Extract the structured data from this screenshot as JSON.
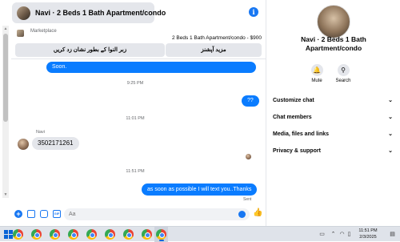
{
  "header": {
    "title": "Navi · 2 Beds 1 Bath Apartment/condo"
  },
  "marketplace": {
    "label": "Marketplace",
    "listing": "2 Beds 1 Bath Apartment/condo - $900",
    "button_1": "زبر النوا کے بطور نشان زد کریں",
    "button_2": "مزید آپشنز"
  },
  "messages": {
    "m1": "Soon.",
    "t1": "9:25 PM",
    "m2": "??",
    "t2": "11:01 PM",
    "sender": "Navi",
    "m3": "3502171261",
    "t3": "11:51 PM",
    "m4": "as soon as possible I will text you..Thanks",
    "status": "Sent"
  },
  "composer": {
    "placeholder": "Aa"
  },
  "panel": {
    "title": "Navi · 2 Beds 1 Bath Apartment/condo",
    "mute_label": "Mute",
    "search_label": "Search",
    "sections": [
      "Customize chat",
      "Chat members",
      "Media, files and links",
      "Privacy & support"
    ]
  },
  "taskbar": {
    "time": "11:51 PM",
    "date": "2/3/2025"
  },
  "colors": {
    "accent": "#1877f2",
    "outgoing_bubble": "#0a7cff",
    "incoming_bubble": "#e4e6eb"
  }
}
